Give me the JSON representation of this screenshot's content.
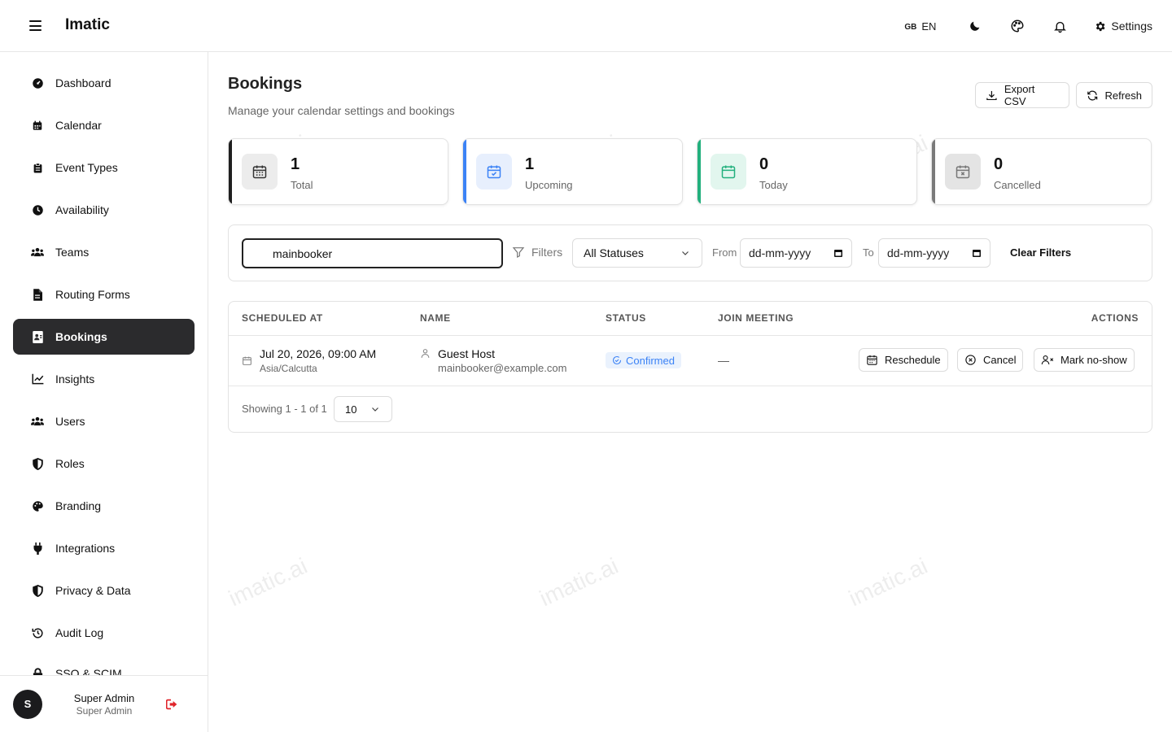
{
  "app": {
    "brand": "Imatic"
  },
  "header": {
    "lang_flag": "GB",
    "lang_code": "EN",
    "settings_label": "Settings"
  },
  "sidebar": {
    "items": [
      {
        "label": "Dashboard",
        "icon": "dashboard-icon"
      },
      {
        "label": "Calendar",
        "icon": "calendar-icon"
      },
      {
        "label": "Event Types",
        "icon": "clipboard-icon"
      },
      {
        "label": "Availability",
        "icon": "clock-icon"
      },
      {
        "label": "Teams",
        "icon": "users-icon"
      },
      {
        "label": "Routing Forms",
        "icon": "document-icon"
      },
      {
        "label": "Bookings",
        "icon": "id-card-icon",
        "active": true
      },
      {
        "label": "Insights",
        "icon": "line-chart-icon"
      },
      {
        "label": "Users",
        "icon": "users-icon"
      },
      {
        "label": "Roles",
        "icon": "shield-icon"
      },
      {
        "label": "Branding",
        "icon": "palette-icon"
      },
      {
        "label": "Integrations",
        "icon": "plug-icon"
      },
      {
        "label": "Privacy & Data",
        "icon": "shield-icon"
      },
      {
        "label": "Audit Log",
        "icon": "history-icon"
      },
      {
        "label": "SSO & SCIM",
        "icon": "lock-icon"
      }
    ],
    "user": {
      "initial": "S",
      "name": "Super Admin",
      "role": "Super Admin"
    }
  },
  "page": {
    "title": "Bookings",
    "subtitle": "Manage your calendar settings and bookings",
    "export_label": "Export CSV",
    "refresh_label": "Refresh"
  },
  "stats": [
    {
      "value": "1",
      "label": "Total",
      "accent": "#1f1f1f",
      "icon_bg": "#ececec",
      "icon_color": "#333333"
    },
    {
      "value": "1",
      "label": "Upcoming",
      "accent": "#3b82f6",
      "icon_bg": "#e7effd",
      "icon_color": "#3b82f6"
    },
    {
      "value": "0",
      "label": "Today",
      "accent": "#22b07d",
      "icon_bg": "#e2f6ee",
      "icon_color": "#22b07d"
    },
    {
      "value": "0",
      "label": "Cancelled",
      "accent": "#7a7a7a",
      "icon_bg": "#e4e4e4",
      "icon_color": "#777777"
    }
  ],
  "filters": {
    "search_value": "mainbooker",
    "filters_label": "Filters",
    "status_selected": "All Statuses",
    "from_label": "From",
    "from_value": "dd-mm-yyyy",
    "to_label": "To",
    "to_value": "dd-mm-yyyy",
    "clear_label": "Clear Filters"
  },
  "table": {
    "columns": [
      "SCHEDULED AT",
      "NAME",
      "STATUS",
      "JOIN MEETING",
      "ACTIONS"
    ],
    "rows": [
      {
        "datetime": "Jul 20, 2026, 09:00 AM",
        "timezone": "Asia/Calcutta",
        "name": "Guest Host",
        "email": "mainbooker@example.com",
        "status": "Confirmed",
        "join": "—",
        "actions": [
          "Reschedule",
          "Cancel",
          "Mark no-show"
        ]
      }
    ],
    "pagination": {
      "info": "Showing 1 - 1 of 1",
      "page_size": "10"
    }
  },
  "watermark": "imatic.ai"
}
